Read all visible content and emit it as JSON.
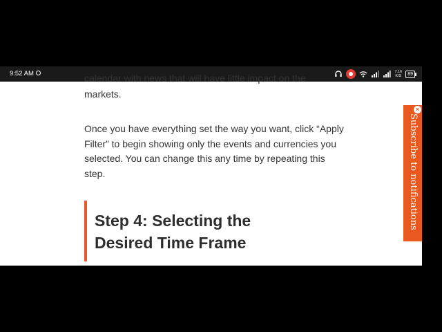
{
  "status_bar": {
    "time": "9:52 AM",
    "net_speed_top": "7.16",
    "net_speed_bottom": "K/S",
    "battery": "89"
  },
  "article": {
    "cut_line": "calendar with news that will have little impact on the",
    "markets_line": "markets.",
    "paragraph": "Once you have everything set the way you want, click “Apply Filter” to begin showing only the events and currencies you selected. You can change this any time by repeating this step.",
    "heading_line1": "Step 4: Selecting the",
    "heading_line2": "Desired Time Frame"
  },
  "subscribe": {
    "label": "Subscribe to notifications",
    "close_label": "×"
  },
  "colors": {
    "accent": "#e8581f",
    "heading_bar": "#e25d2a",
    "text": "#333333"
  }
}
